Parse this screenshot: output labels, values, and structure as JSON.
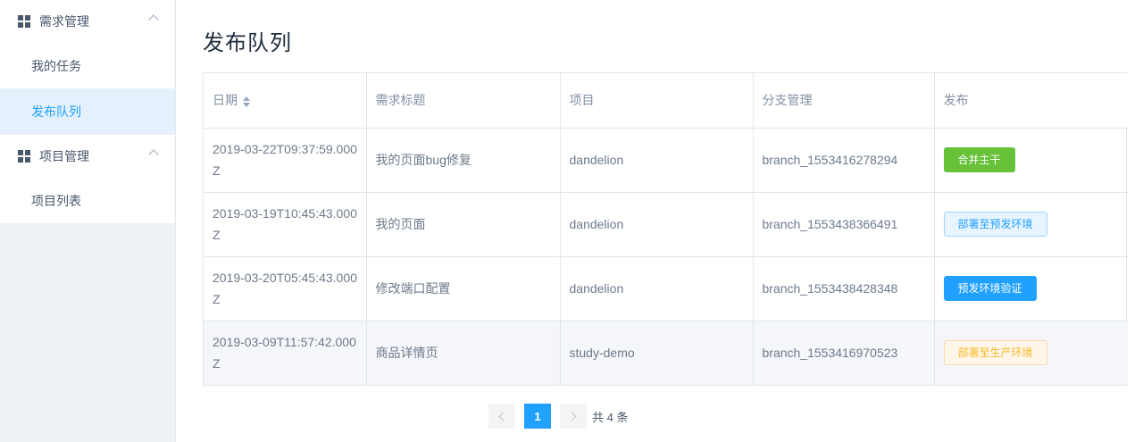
{
  "sidebar": {
    "groups": [
      {
        "title": "需求管理",
        "items": [
          "我的任务",
          "发布队列"
        ]
      },
      {
        "title": "项目管理",
        "items": [
          "项目列表"
        ]
      }
    ]
  },
  "page": {
    "title": "发布队列"
  },
  "table": {
    "headers": [
      "日期",
      "需求标题",
      "项目",
      "分支管理",
      "发布"
    ],
    "rows": [
      {
        "date": "2019-03-22T09:37:59.000Z",
        "title": "我的页面bug修复",
        "project": "dandelion",
        "branch": "branch_1553416278294",
        "action": "合并主干"
      },
      {
        "date": "2019-03-19T10:45:43.000Z",
        "title": "我的页面",
        "project": "dandelion",
        "branch": "branch_1553438366491",
        "action": "部署至预发环境"
      },
      {
        "date": "2019-03-20T05:45:43.000Z",
        "title": "修改端口配置",
        "project": "dandelion",
        "branch": "branch_1553438428348",
        "action": "预发环境验证"
      },
      {
        "date": "2019-03-09T11:57:42.000Z",
        "title": "商品详情页",
        "project": "study-demo",
        "branch": "branch_1553416970523",
        "action": "部署至生产环境"
      }
    ]
  },
  "pagination": {
    "current": "1",
    "total_text": "共 4 条"
  },
  "colors": {
    "accent": "#20a0ff",
    "success": "#67c23a",
    "warning": "#f7ba2a"
  }
}
